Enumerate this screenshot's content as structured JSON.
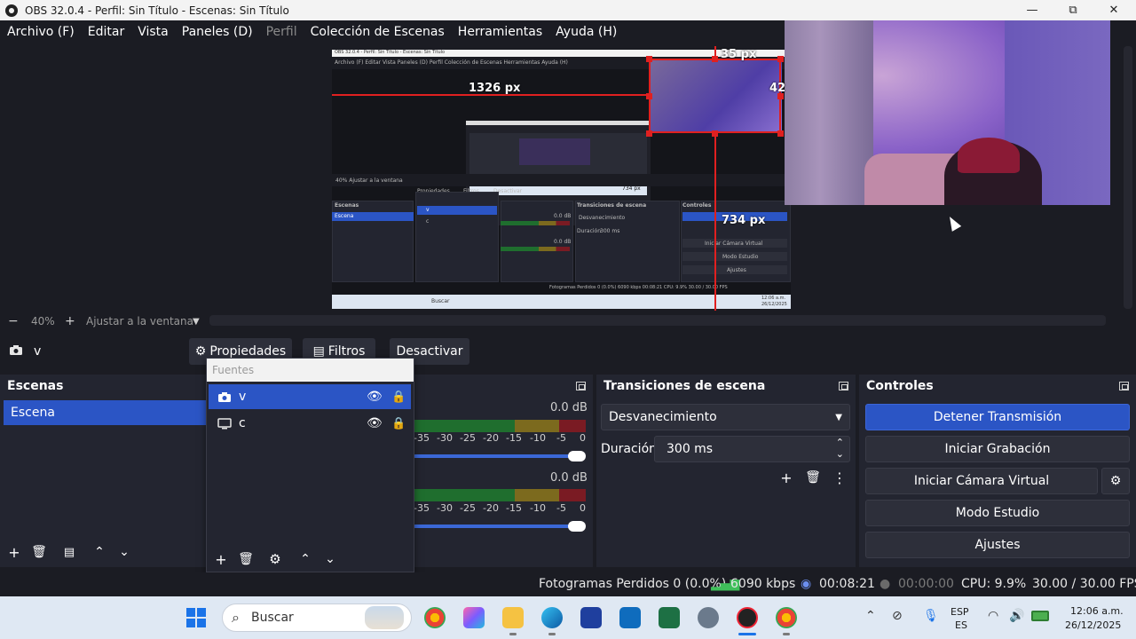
{
  "window": {
    "title": "OBS 32.0.4 - Perfil: Sin Título - Escenas: Sin Título",
    "minimize": "—",
    "maximize": "⧉",
    "close": "✕"
  },
  "menu": [
    "Archivo (F)",
    "Editar",
    "Vista",
    "Paneles (D)",
    "Perfil",
    "Colección de Escenas",
    "Herramientas",
    "Ayuda (H)"
  ],
  "preview": {
    "guide_top": "35 px",
    "guide_left": "1326 px",
    "guide_right": "42",
    "guide_bottom": "734 px",
    "mini": {
      "title": "OBS 32.0.4 - Perfil: Sin Título - Escenas: Sin Título",
      "menu": "Archivo (F)  Editar  Vista  Paneles (D)  Perfil  Colección de Escenas  Herramientas  Ayuda (H)",
      "scenes": "Escenas",
      "scene": "Escena",
      "transitions": "Transiciones de escena",
      "fade": "Desvanecimiento",
      "duration": "Duración",
      "duration_val": "300 ms",
      "controls": "Controles",
      "stop": "Detener Transmisión",
      "start_vcam": "Iniciar Cámara Virtual",
      "studio": "Modo Estudio",
      "settings": "Ajustes",
      "status": "Fotogramas Perdidos 0 (0.0%)   6090 kbps   00:08:21   CPU: 9.9%   30.00 / 30.00 FPS",
      "source_v": "v",
      "source_c": "c",
      "zoom": "40%  Ajustar a la ventana",
      "props": "Propiedades",
      "filters": "Filtros",
      "deactivate": "Desactivar",
      "search": "Buscar",
      "clock": "12:06 a.m.",
      "date": "26/12/2025",
      "db": "0.0 dB"
    }
  },
  "zoom": {
    "minus": "−",
    "value": "40%",
    "plus": "+",
    "fit": "Ajustar a la ventana"
  },
  "source_toolbar": {
    "selected_source": "v",
    "properties": "Propiedades",
    "filters": "Filtros",
    "deactivate": "Desactivar"
  },
  "scenes": {
    "title": "Escenas",
    "items": [
      "Escena"
    ]
  },
  "sources": {
    "title": "Fuentes",
    "items": [
      {
        "name": "v"
      },
      {
        "name": "c"
      }
    ]
  },
  "mixer": {
    "tracks": [
      {
        "db": "0.0 dB"
      },
      {
        "db": "0.0 dB"
      }
    ],
    "scale": [
      "-35",
      "-30",
      "-25",
      "-20",
      "-15",
      "-10",
      "-5",
      "0"
    ]
  },
  "transitions": {
    "title": "Transiciones de escena",
    "selected": "Desvanecimiento",
    "duration_label": "Duración",
    "duration_value": "300 ms"
  },
  "controls": {
    "title": "Controles",
    "stop_stream": "Detener Transmisión",
    "start_recording": "Iniciar Grabación",
    "start_virtual_cam": "Iniciar Cámara Virtual",
    "studio_mode": "Modo Estudio",
    "settings": "Ajustes"
  },
  "status": {
    "dropped_frames": "Fotogramas Perdidos 0 (0.0%)",
    "bitrate": "6090 kbps",
    "stream_time": "00:08:21",
    "record_time": "00:00:00",
    "cpu": "CPU: 9.9%",
    "fps": "30.00 / 30.00 FPS"
  },
  "taskbar": {
    "search_placeholder": "Buscar",
    "lang_top": "ESP",
    "lang_bottom": "ES",
    "time": "12:06 a.m.",
    "date": "26/12/2025"
  },
  "colors": {
    "accent": "#2b55c5",
    "background": "#1b1c23",
    "panel": "#232530",
    "guide": "#e02020"
  }
}
